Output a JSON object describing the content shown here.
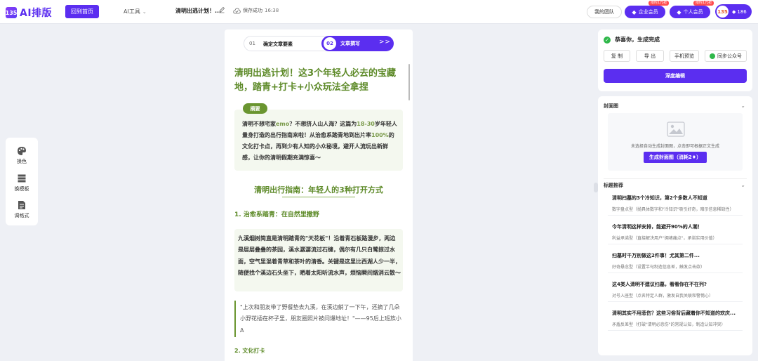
{
  "app": {
    "logo_text": "AI排版",
    "logo_mark": "135",
    "home_button": "回到首页",
    "ai_tools": "AI工具",
    "doc_title": "清明出逃计划！...",
    "save_status": "保存成功",
    "save_time": "16:38",
    "team_button": "我的团队",
    "enterprise_member": "企业会员",
    "enterprise_badge": "限时1元抢",
    "personal_member": "个人会员",
    "personal_badge": "限时1元抢",
    "avatar_text": "135",
    "credits": "186"
  },
  "left_tools": [
    {
      "label": "换色",
      "icon": "palette-icon"
    },
    {
      "label": "换模板",
      "icon": "template-icon"
    },
    {
      "label": "调格式",
      "icon": "format-icon"
    }
  ],
  "steps": {
    "step1_num": "01",
    "step1_label": "确定文章要素",
    "step2_num": "02",
    "step2_label": "文章撰写",
    "step2_arrow": "> >"
  },
  "article": {
    "title": "清明出逃计划！这3个年轻人必去的宝藏地，踏青+打卡+小众玩法全拿捏",
    "summary_tag": "摘要",
    "summary_parts": [
      "清明不想宅家",
      "emo",
      "？不想挤人山人海？这篇为",
      "18-30",
      "岁年轻人量身打造的出行指南来啦！从治愈系踏青地到出片率",
      "100%",
      "的文化打卡点，再到少有人知的小众秘境，避开人流玩出新鲜感，让你的清明假期充满惊喜～"
    ],
    "h2": "清明出行指南：年轻人的3种打开方式",
    "h3": "1. 治愈系踏青：在自然里撒野",
    "paragraph": "九溪烟树简直是清明踏青的\"天花板\"！沿着青石板路漫步，两边是层层叠叠的茶园，溪水潺潺流过石缝，偶尔有几只白鹭掠过水面，空气里混着青草和茶叶的清香。关键是这里比西湖人少一半，随便找个溪边石头坐下，晒着太阳听流水声，烦恼瞬间烟消云散～",
    "quote": "\"上次和朋友带了野餐垫去九溪，在溪边躺了一下午，还摘了几朵小野花插在杯子里，朋友圈照片被问爆地址！\"——95后上班族小A",
    "cut_line": "2. 文化打卡"
  },
  "right_top": {
    "success": "恭喜你，生成完成",
    "copy": "复 制",
    "export": "导 出",
    "preview": "手机预览",
    "sync": "同步公众号",
    "deep_edit": "深度编辑"
  },
  "cover": {
    "title": "封面图",
    "hint": "未选择自动生成封面图，点击即可根据正文生成",
    "button": "生成封面图（消耗2",
    "button_gem": "♦",
    "button_end": "）"
  },
  "titles": {
    "header": "标题推荐",
    "items": [
      {
        "title": "清明扫墓的3个冷知识，第2个多数人不知道",
        "sub": "数字盘点型（抛具体数字和\"冷知识\"吸引好奇，暗示信息稀缺性）"
      },
      {
        "title": "今年清明这样安排，能避开90%的人潮！",
        "sub": "利益承诺型（直接解决用户\"拥堵痛点\"，承诺实用价值）"
      },
      {
        "title": "扫墓时千万别做这2件事！尤其第二件...",
        "sub": "好奇悬念型（设置半句制造信息差，触发点击欲）"
      },
      {
        "title": "这4类人清明不建议扫墓，看看你在不在列?",
        "sub": "对号入座型（点名特定人群，激发自我关联和警惕心）"
      },
      {
        "title": "清明其实不用悲伤？这些习俗背后藏着你不知道的欢庆...",
        "sub": "矛盾反差型（打破\"清明必悲伤\"的常规认知，制造认知冲突）"
      }
    ]
  },
  "colors": {
    "brand": "#5b2ef0",
    "article_green": "#5d8a28",
    "success_green": "#2fb84a"
  }
}
